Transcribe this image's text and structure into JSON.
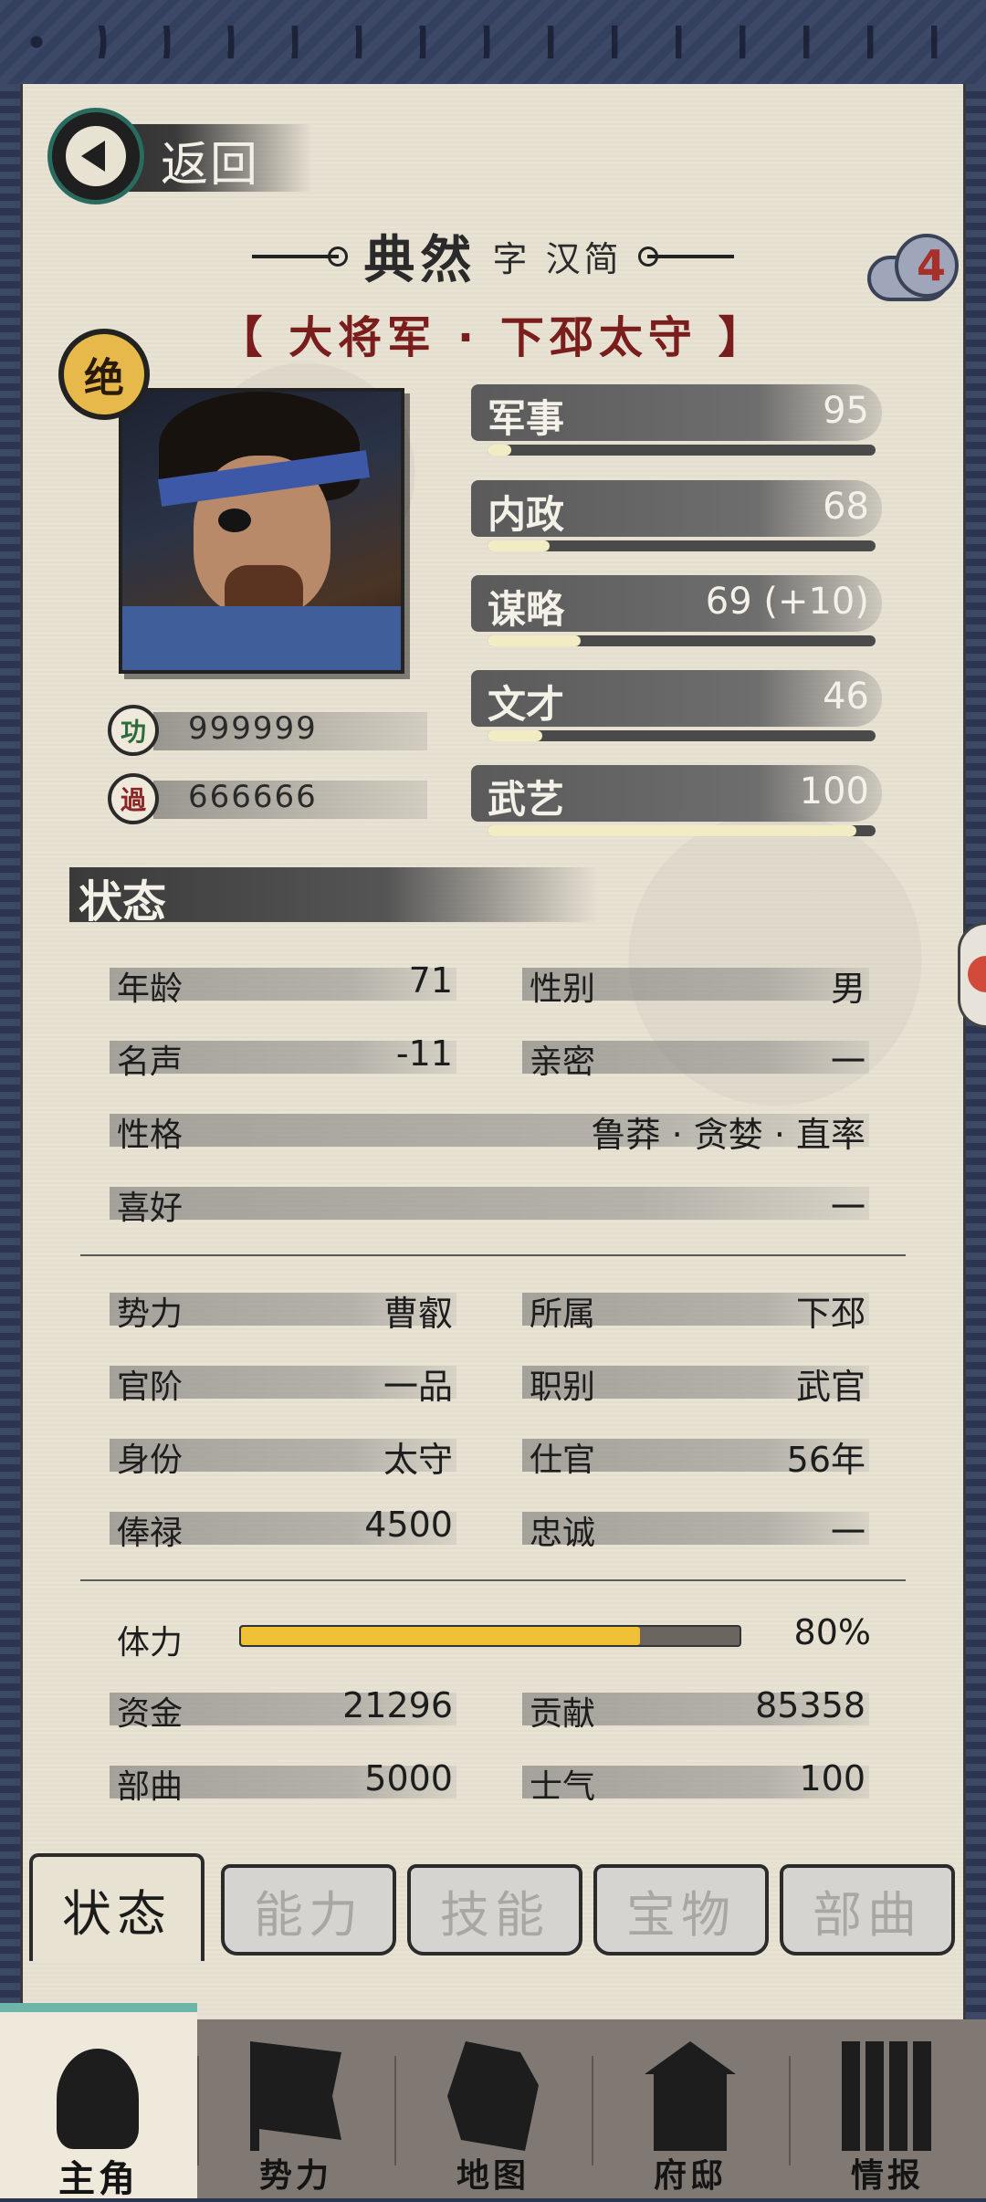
{
  "header": {
    "back_label": "返回"
  },
  "character": {
    "name": "典然",
    "zi": "字 汉简",
    "titles": "【 大将军 · 下邳太守 】",
    "grade": "绝",
    "level_badge": "4",
    "merit_label": "功",
    "demerit_label": "過",
    "merit_marks": "999999",
    "demerit_marks": "666666"
  },
  "abilities": [
    {
      "label": "军事",
      "value": "95",
      "fraction": 0.06
    },
    {
      "label": "内政",
      "value": "68",
      "fraction": 0.16
    },
    {
      "label": "谋略",
      "value": "69 (+10)",
      "fraction": 0.24
    },
    {
      "label": "文才",
      "value": "46",
      "fraction": 0.14
    },
    {
      "label": "武艺",
      "value": "100",
      "fraction": 0.95
    }
  ],
  "status_section": {
    "title": "状态"
  },
  "personal": {
    "age_k": "年龄",
    "age_v": "71",
    "gender_k": "性别",
    "gender_v": "男",
    "fame_k": "名声",
    "fame_v": "-11",
    "intimacy_k": "亲密",
    "intimacy_v": "一",
    "personality_k": "性格",
    "personality_v": "鲁莽 · 贪婪 · 直率",
    "hobby_k": "喜好",
    "hobby_v": "一"
  },
  "official": {
    "faction_k": "势力",
    "faction_v": "曹叡",
    "belong_k": "所属",
    "belong_v": "下邳",
    "rank_k": "官阶",
    "rank_v": "一品",
    "post_k": "职别",
    "post_v": "武官",
    "identity_k": "身份",
    "identity_v": "太守",
    "service_k": "仕官",
    "service_v": "56年",
    "salary_k": "俸禄",
    "salary_v": "4500",
    "loyalty_k": "忠诚",
    "loyalty_v": "一"
  },
  "resources": {
    "stamina_k": "体力",
    "stamina_v": "80%",
    "stamina_fraction": 0.8,
    "funds_k": "资金",
    "funds_v": "21296",
    "contrib_k": "贡献",
    "contrib_v": "85358",
    "troops_k": "部曲",
    "troops_v": "5000",
    "morale_k": "士气",
    "morale_v": "100"
  },
  "tabs": [
    "状态",
    "能力",
    "技能",
    "宝物",
    "部曲"
  ],
  "bottom_nav": [
    "主角",
    "势力",
    "地图",
    "府邸",
    "情报"
  ]
}
